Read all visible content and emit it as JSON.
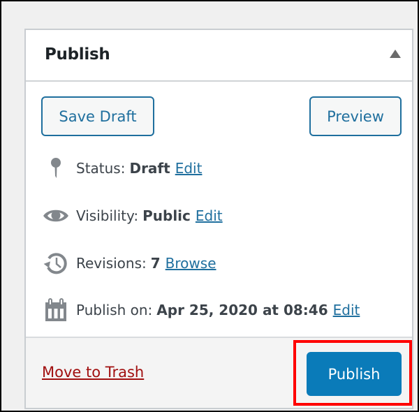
{
  "panel": {
    "title": "Publish",
    "toggle_icon": "triangle-up-icon"
  },
  "actions": {
    "save_draft": "Save Draft",
    "preview": "Preview"
  },
  "status": {
    "icon": "pin-icon",
    "label": "Status:",
    "value": "Draft",
    "link": "Edit"
  },
  "visibility": {
    "icon": "eye-icon",
    "label": "Visibility:",
    "value": "Public",
    "link": "Edit"
  },
  "revisions": {
    "icon": "history-icon",
    "label": "Revisions:",
    "value": "7",
    "link": "Browse"
  },
  "schedule": {
    "icon": "calendar-icon",
    "label": "Publish on:",
    "value": "Apr 25, 2020 at 08:46",
    "link": "Edit"
  },
  "footer": {
    "trash": "Move to Trash",
    "publish": "Publish"
  },
  "colors": {
    "primary": "#0a7bb9",
    "link": "#1f6f9e",
    "danger": "#a10f0f",
    "highlight": "#ff0000"
  }
}
